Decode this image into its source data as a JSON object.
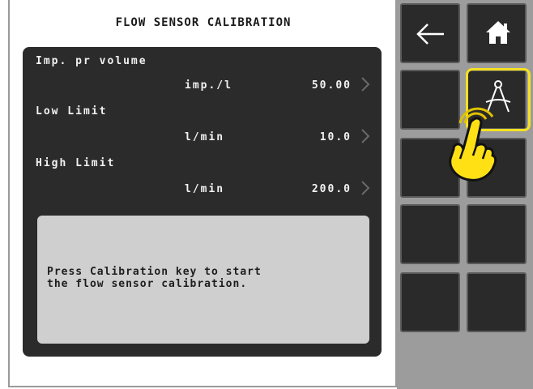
{
  "screen": {
    "title": "FLOW SENSOR CALIBRATION"
  },
  "parameters": [
    {
      "label": "Imp. pr volume",
      "unit": "imp./l",
      "value": "50.00"
    },
    {
      "label": "Low Limit",
      "unit": "l/min",
      "value": "10.0"
    },
    {
      "label": "High Limit",
      "unit": "l/min",
      "value": "200.0"
    }
  ],
  "info": {
    "message": "Press Calibration key to start\nthe flow sensor calibration."
  },
  "softkeys": [
    {
      "name": "back",
      "icon": "arrow-left-icon"
    },
    {
      "name": "home",
      "icon": "home-icon"
    },
    {
      "name": "empty-1",
      "icon": ""
    },
    {
      "name": "calibration",
      "icon": "compass-drafting-icon"
    },
    {
      "name": "empty-2",
      "icon": ""
    },
    {
      "name": "empty-3",
      "icon": ""
    },
    {
      "name": "empty-4",
      "icon": ""
    },
    {
      "name": "empty-5",
      "icon": ""
    },
    {
      "name": "empty-6",
      "icon": ""
    },
    {
      "name": "empty-7",
      "icon": ""
    }
  ],
  "colors": {
    "panel": "#2b2b2b",
    "info_box": "#cfcfcf",
    "highlight": "#f5e11f",
    "softkey": "#2a2a2a",
    "sidebar": "#9c9c9c"
  }
}
